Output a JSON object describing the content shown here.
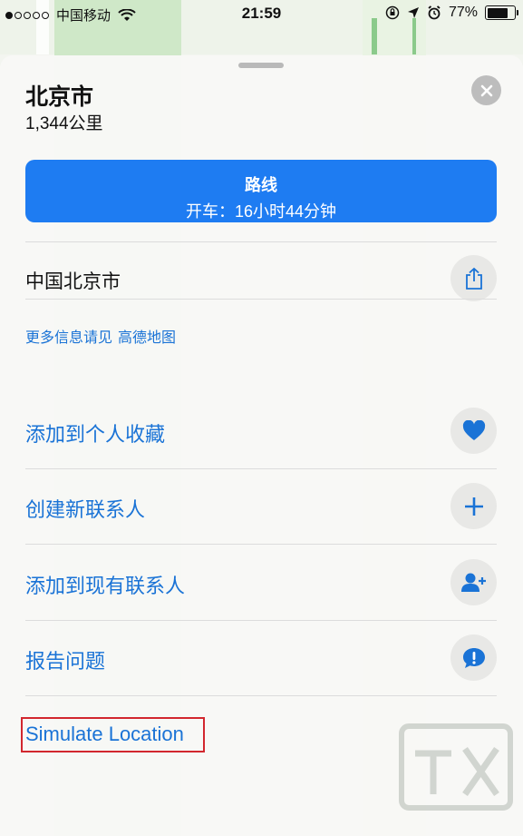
{
  "status_bar": {
    "signal_dots": [
      true,
      false,
      false,
      false,
      false
    ],
    "carrier": "中国移动",
    "time": "21:59",
    "battery_percent": "77%",
    "battery_level": 0.77
  },
  "place": {
    "title": "北京市",
    "distance": "1,344公里"
  },
  "directions": {
    "title": "路线",
    "subtitle": "开车：16小时44分钟"
  },
  "address": "中国北京市",
  "more_info": {
    "prefix": "更多信息请见",
    "provider": "高德地图"
  },
  "actions": [
    {
      "label": "添加到个人收藏",
      "icon": "heart-icon"
    },
    {
      "label": "创建新联系人",
      "icon": "plus-icon"
    },
    {
      "label": "添加到现有联系人",
      "icon": "add-person-icon"
    },
    {
      "label": "报告问题",
      "icon": "exclamation-bubble-icon"
    }
  ],
  "simulate_location": "Simulate Location",
  "colors": {
    "accent": "#1a73d6",
    "button_blue": "#1e7cf2",
    "highlight_red": "#d2272e"
  }
}
